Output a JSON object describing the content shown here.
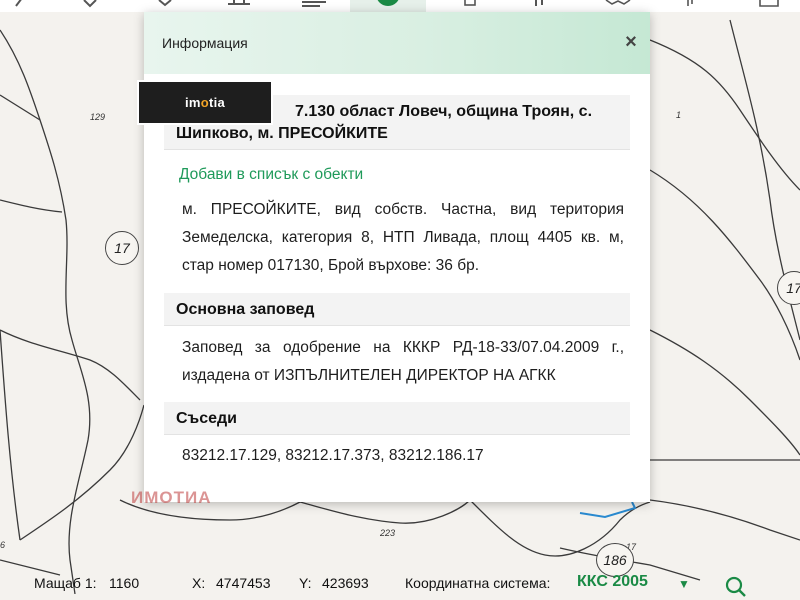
{
  "dialog": {
    "title": "Информация",
    "close_glyph": "×",
    "heading_visible": "7.130 област Ловеч, община Троян, с. Шипково, м. ПРЕСОЙКИТЕ",
    "add_to_list": "Добави в списък с обекти",
    "description": "м. ПРЕСОЙКИТЕ, вид собств. Частна, вид територия Земеделска, категория 8, НТП Ливада, площ 4405 кв. м, стар номер 017130, Брой върхове: 36 бр.",
    "order_heading": "Основна заповед",
    "order_text": "Заповед за одобрение на КККР РД-18-33/07.04.2009 г., издадена от ИЗПЪЛНИТЕЛЕН ДИРЕКТОР НА АГКК",
    "neighbors_heading": "Съседи",
    "neighbors_text": "83212.17.129, 83212.17.373, 83212.186.17"
  },
  "logo": {
    "part1": "im",
    "part2": "o",
    "part3": "tia"
  },
  "watermark": "ИМОТИА",
  "map_labels": {
    "plot_129": "129",
    "plot_1": "1",
    "plot_223": "223",
    "plot_17_small": "17",
    "plot_6": "6",
    "circle_17_left": "17",
    "circle_17_right": "17",
    "circle_186": "186"
  },
  "statusbar": {
    "scale_label": "Мащаб 1:",
    "scale_value": "1160",
    "x_label": "X:",
    "x_value": "4747453",
    "y_label": "Y:",
    "y_value": "423693",
    "crs_label": "Координатна система:",
    "crs_value": "ККС 2005",
    "dropdown_glyph": "▼"
  },
  "colors": {
    "accent_green": "#1a8a45",
    "link_green": "#1f9a5a",
    "header_gradient_start": "#e8f5ee",
    "header_gradient_end": "#c5e8d4",
    "highlight_blue": "#2a8ad0"
  },
  "icons": {
    "toolbar": [
      "chevron-left-icon",
      "pin-icon",
      "bookmark-icon",
      "measure-icon",
      "layers-icon",
      "info-active-icon",
      "print-icon",
      "stats-icon",
      "map-icon",
      "tools-icon",
      "export-icon"
    ],
    "close": "close-icon",
    "search": "search-icon",
    "dropdown": "chevron-down-icon"
  }
}
